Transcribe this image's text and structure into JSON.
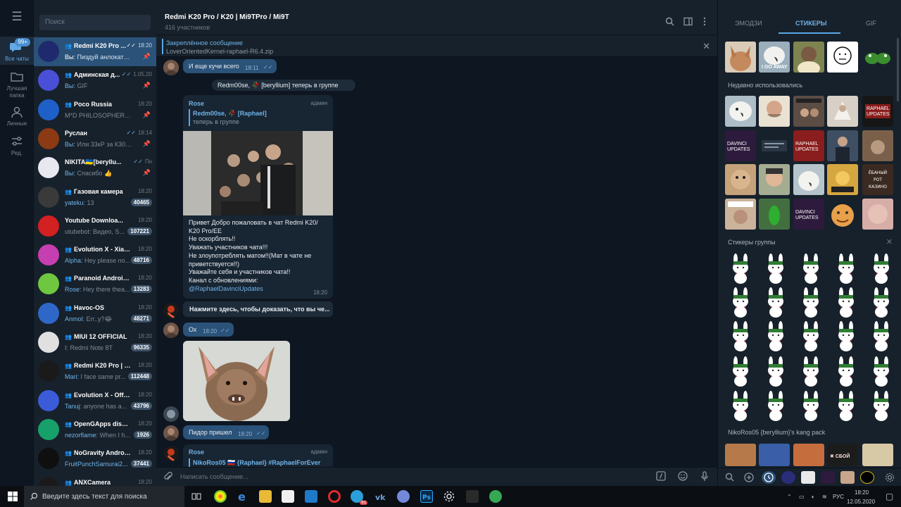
{
  "header": {
    "title": "Redmi K20 Pro / K20 | Mi9TPro / Mi9T",
    "members": "416 участников"
  },
  "pinned": {
    "title": "Закреплённое сообщение",
    "text": "LoverOrientedKernel-raphael-R6.4.zip"
  },
  "rail": {
    "all_badge": "99+",
    "all": "Все чаты",
    "best": "Лучшая папка",
    "personal": "Личные",
    "edit": "Ред."
  },
  "search_placeholder": "Поиск",
  "chats": [
    {
      "name": "Redmi K20 Pro ...",
      "group": true,
      "time": "18:20",
      "who": "Вы:",
      "preview": "Пиздуй анлокать за...",
      "badge": "",
      "pinned": true,
      "check": true
    },
    {
      "name": "Админская д...",
      "group": true,
      "time": "1.05.20",
      "who": "Вы:",
      "preview": "GIF",
      "badge": "",
      "pinned": true,
      "check": true
    },
    {
      "name": "Poco Russia",
      "group": true,
      "time": "18:20",
      "who": "",
      "preview": "M*D PHILOSOPHER з...",
      "badge": "",
      "pinned": true,
      "check": false
    },
    {
      "name": "Руслан",
      "group": false,
      "time": "18:14",
      "who": "Вы:",
      "preview": "Или 33кР за К30 Pro?)",
      "badge": "",
      "pinned": true,
      "check": true
    },
    {
      "name": "NIKITA🇺🇦[beryllu...",
      "group": false,
      "time": "Пн",
      "who": "Вы:",
      "preview": "Спасибо 👍",
      "badge": "",
      "pinned": true,
      "check": true
    },
    {
      "name": "Газовая камера",
      "group": true,
      "time": "18:20",
      "who": "yateku:",
      "preview": "13",
      "badge": "40465",
      "pinned": false,
      "check": false
    },
    {
      "name": "Youtube Downloa...",
      "group": false,
      "time": "18:20",
      "who": "",
      "preview": "utubebot: Видео, S...",
      "badge": "107221",
      "pinned": false,
      "check": false
    },
    {
      "name": "Evolution X - Xiao...",
      "group": true,
      "time": "18:20",
      "who": "Alpha:",
      "preview": "Hey please no...",
      "badge": "48716",
      "pinned": false,
      "check": false
    },
    {
      "name": "Paranoid Android...",
      "group": true,
      "time": "18:20",
      "who": "Rose:",
      "preview": "Hey there thea...",
      "badge": "13283",
      "pinned": false,
      "check": false
    },
    {
      "name": "Havoc-OS",
      "group": true,
      "time": "18:20",
      "who": "Anmol:",
      "preview": "Err..y?😂",
      "badge": "48271",
      "pinned": false,
      "check": false
    },
    {
      "name": "MIUI 12 OFFICIAL",
      "group": true,
      "time": "18:20",
      "who": "",
      "preview": "I: Redmi Note 8T",
      "badge": "96335",
      "pinned": false,
      "check": false
    },
    {
      "name": "Redmi K20 Pro | M...",
      "group": true,
      "time": "18:20",
      "who": "Mari:",
      "preview": "I face same pr...",
      "badge": "112448",
      "pinned": false,
      "check": false
    },
    {
      "name": "Evolution X - Offici...",
      "group": true,
      "time": "18:20",
      "who": "Tanuj:",
      "preview": "anyone has a...",
      "badge": "43796",
      "pinned": false,
      "check": false
    },
    {
      "name": "OpenGApps discus...",
      "group": true,
      "time": "18:20",
      "who": "nezorflame:",
      "preview": "When I h...",
      "badge": "1926",
      "pinned": false,
      "check": false
    },
    {
      "name": "NoGravity Androi...",
      "group": true,
      "time": "18:20",
      "who": "FruitPunchSamurai2...",
      "preview": "",
      "badge": "37441",
      "pinned": false,
      "check": false
    },
    {
      "name": "ANXCamera",
      "group": true,
      "time": "18:20",
      "who": "",
      "preview": "",
      "badge": "",
      "pinned": false,
      "check": false
    }
  ],
  "messages": {
    "m1_text": "И еще кучи всего",
    "m1_time": "18:11",
    "service": "Redm00se, 🥀 [beryllium] теперь в группе",
    "rose_name": "Rose",
    "rose_role": "админ",
    "rose_quote_name": "Redm00se, 🥀 [Raphael]",
    "rose_quote_text": "теперь в группе",
    "welcome": [
      "Привет Добро пожаловать в чат Redmi K20/",
      "K20 Pro/EE",
      "Не оскорблять!!",
      "Уважать участников чата!!!",
      "Не злоупотреблять матом!!(Мат в чате не",
      "приветствуется!!)",
      "Уважайте себя и участников чата!!",
      "Канал с обновлениями:"
    ],
    "welcome_link": "@RaphaelDavinciUpdates",
    "welcome_time": "18:20",
    "verify": "Нажмите здесь, чтобы доказать, что вы че...",
    "m2_text": "Ох",
    "m2_time": "18:20",
    "m3_text": "Пидор пришел",
    "m3_time": "18:20",
    "rose2_name": "Rose",
    "rose2_role": "админ",
    "rose2_quote": "NikoRos05 🇷🇺 {Raphael} #RaphaelForEver"
  },
  "composer_placeholder": "Написать сообщение...",
  "panel": {
    "tab_emoji": "ЭМОДЗИ",
    "tab_stickers": "СТИКЕРЫ",
    "tab_gif": "GIF",
    "recent": "Недавно использовались",
    "group": "Стикеры группы",
    "kang": "NikoRos05 {beryllium}'s kang pack",
    "sticker_texts": {
      "go_away": "I GO AWAY",
      "davinci": "DAVINCI\nUPDATES",
      "raphael": "RAPHAEL\nUPDATES",
      "fail": "✖ СБОЙ"
    }
  },
  "taskbar": {
    "search": "Введите здесь текст для поиска",
    "lang": "РУС",
    "time": "18:20",
    "date": "12.05.2020",
    "telegram_badge": "61"
  }
}
